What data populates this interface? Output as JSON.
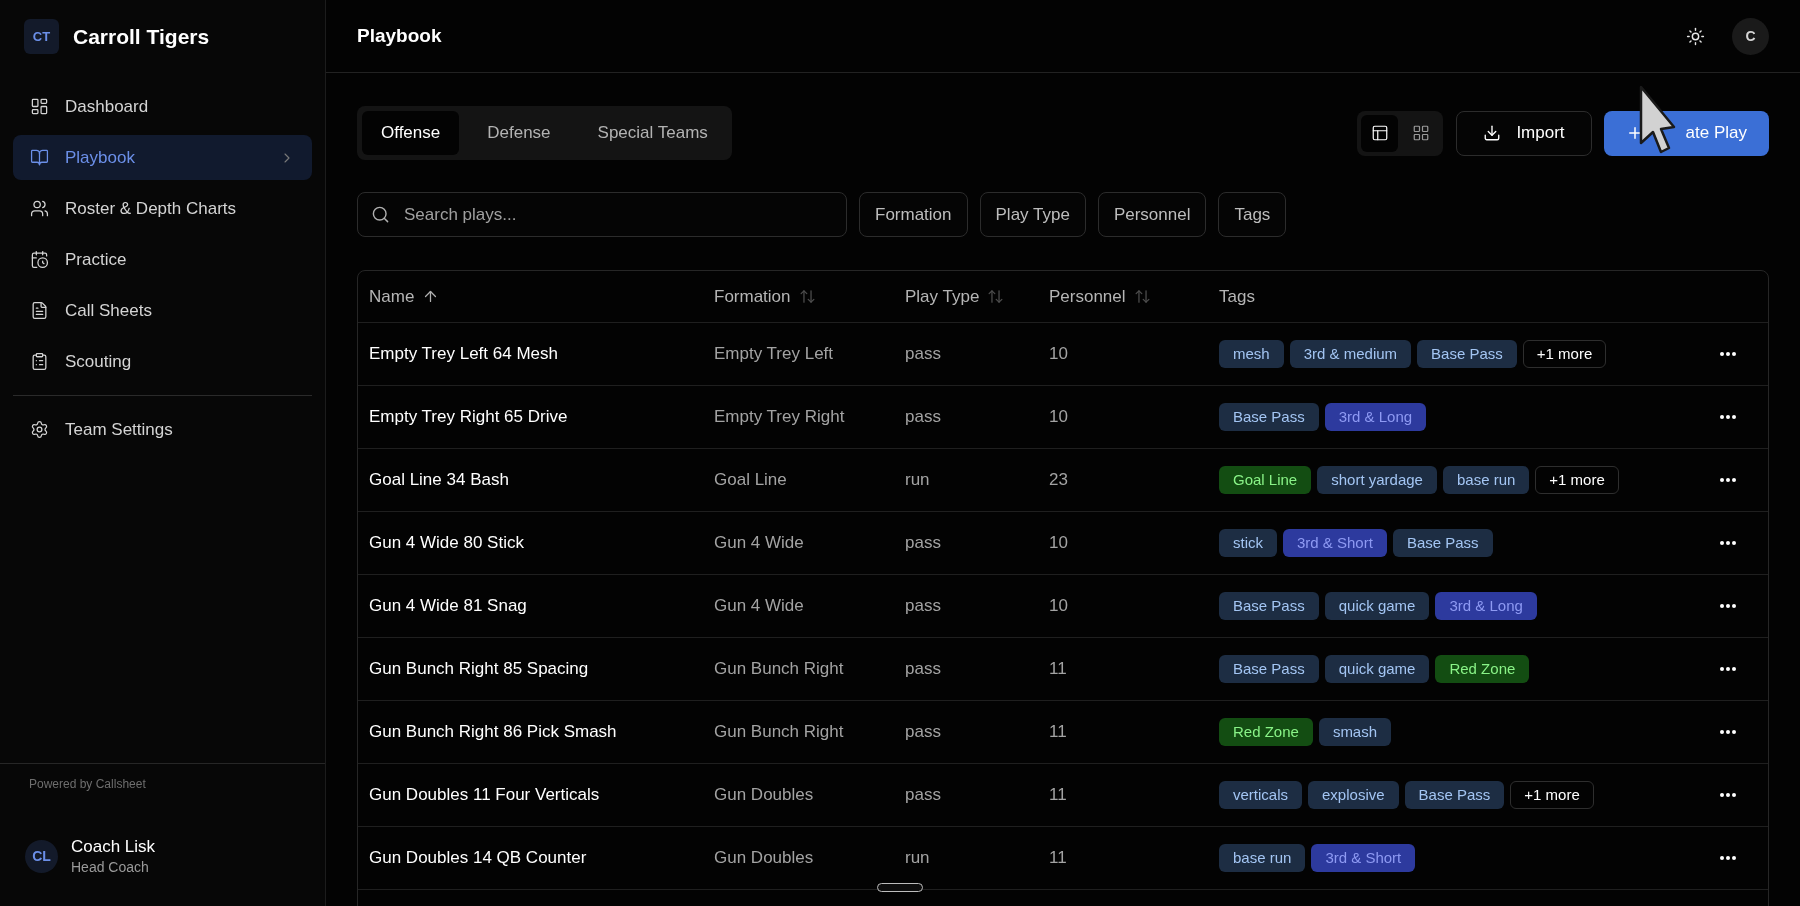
{
  "sidebar": {
    "logo": {
      "initials": "CT",
      "name": "Carroll Tigers"
    },
    "nav": [
      {
        "label": "Dashboard",
        "selected": false
      },
      {
        "label": "Playbook",
        "selected": true
      },
      {
        "label": "Roster & Depth Charts",
        "selected": false
      },
      {
        "label": "Practice",
        "selected": false
      },
      {
        "label": "Call Sheets",
        "selected": false
      },
      {
        "label": "Scouting",
        "selected": false
      }
    ],
    "settings": {
      "label": "Team Settings",
      "selected": false
    },
    "footer": "Powered by Callsheet",
    "user": {
      "initials": "CL",
      "name": "Coach Lisk",
      "role": "Head Coach"
    }
  },
  "header": {
    "title": "Playbook",
    "avatar": "C"
  },
  "tabs": [
    {
      "label": "Offense",
      "selected": true
    },
    {
      "label": "Defense",
      "selected": false
    },
    {
      "label": "Special Teams",
      "selected": false
    }
  ],
  "view_toggle": [
    {
      "selected": true
    },
    {
      "selected": false
    }
  ],
  "import_button": "Import",
  "create_button": "ate Play",
  "search": {
    "placeholder": "Search plays..."
  },
  "filters": [
    "Formation",
    "Play Type",
    "Personnel",
    "Tags"
  ],
  "table": {
    "columns": [
      {
        "label": "Name",
        "sorted": true
      },
      {
        "label": "Formation",
        "sorted": false
      },
      {
        "label": "Play Type",
        "sorted": false
      },
      {
        "label": "Personnel",
        "sorted": false
      },
      {
        "label": "Tags"
      }
    ],
    "rows": [
      {
        "name": "Empty Trey Left 64 Mesh",
        "formation": "Empty Trey Left",
        "play_type": "pass",
        "personnel": "10",
        "tags": [
          {
            "label": "mesh",
            "color": "#1d2d43"
          },
          {
            "label": "3rd & medium",
            "color": "#1d2d43"
          },
          {
            "label": "Base Pass",
            "color": "#1d2d43"
          }
        ],
        "more": "+1 more"
      },
      {
        "name": "Empty Trey Right 65 Drive",
        "formation": "Empty Trey Right",
        "play_type": "pass",
        "personnel": "10",
        "tags": [
          {
            "label": "Base Pass",
            "color": "#1d2d43"
          },
          {
            "label": "3rd & Long",
            "color": "#2d3a9e"
          }
        ]
      },
      {
        "name": "Goal Line 34 Bash",
        "formation": "Goal Line",
        "play_type": "run",
        "personnel": "23",
        "tags": [
          {
            "label": "Goal Line",
            "color": "#134d12"
          },
          {
            "label": "short yardage",
            "color": "#1d2d43"
          },
          {
            "label": "base run",
            "color": "#1d2d43"
          }
        ],
        "more": "+1 more"
      },
      {
        "name": "Gun 4 Wide 80 Stick",
        "formation": "Gun 4 Wide",
        "play_type": "pass",
        "personnel": "10",
        "tags": [
          {
            "label": "stick",
            "color": "#1d2d43"
          },
          {
            "label": "3rd & Short",
            "color": "#2d3a9e"
          },
          {
            "label": "Base Pass",
            "color": "#1d2d43"
          }
        ]
      },
      {
        "name": "Gun 4 Wide 81 Snag",
        "formation": "Gun 4 Wide",
        "play_type": "pass",
        "personnel": "10",
        "tags": [
          {
            "label": "Base Pass",
            "color": "#1d2d43"
          },
          {
            "label": "quick game",
            "color": "#1d2d43"
          },
          {
            "label": "3rd & Long",
            "color": "#2d3a9e"
          }
        ]
      },
      {
        "name": "Gun Bunch Right 85 Spacing",
        "formation": "Gun Bunch Right",
        "play_type": "pass",
        "personnel": "11",
        "tags": [
          {
            "label": "Base Pass",
            "color": "#1d2d43"
          },
          {
            "label": "quick game",
            "color": "#1d2d43"
          },
          {
            "label": "Red Zone",
            "color": "#134d12"
          }
        ]
      },
      {
        "name": "Gun Bunch Right 86 Pick Smash",
        "formation": "Gun Bunch Right",
        "play_type": "pass",
        "personnel": "11",
        "tags": [
          {
            "label": "Red Zone",
            "color": "#134d12"
          },
          {
            "label": "smash",
            "color": "#1d2d43"
          }
        ]
      },
      {
        "name": "Gun Doubles 11 Four Verticals",
        "formation": "Gun Doubles",
        "play_type": "pass",
        "personnel": "11",
        "tags": [
          {
            "label": "verticals",
            "color": "#1d2d43"
          },
          {
            "label": "explosive",
            "color": "#1d2d43"
          },
          {
            "label": "Base Pass",
            "color": "#1d2d43"
          }
        ],
        "more": "+1 more"
      },
      {
        "name": "Gun Doubles 14 QB Counter",
        "formation": "Gun Doubles",
        "play_type": "run",
        "personnel": "11",
        "tags": [
          {
            "label": "base run",
            "color": "#1d2d43"
          },
          {
            "label": "3rd & Short",
            "color": "#2d3a9e"
          }
        ]
      }
    ]
  }
}
